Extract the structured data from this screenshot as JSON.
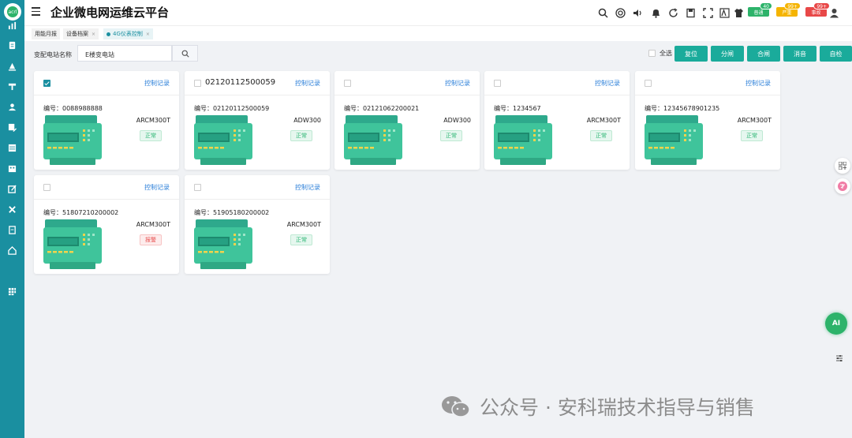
{
  "app": {
    "title": "企业微电网运维云平台",
    "logo_text": "acrl"
  },
  "tabs": [
    {
      "label": "用能月报",
      "closable": false,
      "active": false
    },
    {
      "label": "设备档案",
      "closable": true,
      "active": false
    },
    {
      "label": "4G仪表控制",
      "closable": true,
      "active": true
    }
  ],
  "tab_close_glyph": "×",
  "header_badges": [
    {
      "label": "普通",
      "count": "40",
      "color": "#2db36a"
    },
    {
      "label": "严重",
      "count": "99+",
      "color": "#f5b400"
    },
    {
      "label": "事故",
      "count": "99+",
      "color": "#e84848"
    }
  ],
  "filter": {
    "label": "变配电站名称",
    "value": "E楼变电站"
  },
  "select_all_label": "全选",
  "actions": [
    "复位",
    "分闸",
    "合闸",
    "消音",
    "自检"
  ],
  "control_link": "控制记录",
  "code_prefix": "编号：",
  "cards": [
    {
      "title": "",
      "checked": true,
      "code": "0088988888",
      "model": "ARCM300T",
      "status": "正常",
      "status_type": "ok"
    },
    {
      "title": "02120112500059",
      "checked": false,
      "code": "02120112500059",
      "model": "ADW300",
      "status": "正常",
      "status_type": "ok"
    },
    {
      "title": "",
      "checked": false,
      "code": "02121062200021",
      "model": "ADW300",
      "status": "正常",
      "status_type": "ok"
    },
    {
      "title": "",
      "checked": false,
      "code": "1234567",
      "model": "ARCM300T",
      "status": "正常",
      "status_type": "ok"
    },
    {
      "title": "",
      "checked": false,
      "code": "12345678901235",
      "model": "ARCM300T",
      "status": "正常",
      "status_type": "ok"
    },
    {
      "title": "",
      "checked": false,
      "code": "51807210200002",
      "model": "ARCM300T",
      "status": "报警",
      "status_type": "bad"
    },
    {
      "title": "",
      "checked": false,
      "code": "51905180200002",
      "model": "ARCM300T",
      "status": "正常",
      "status_type": "ok"
    }
  ],
  "ai_label": "AI",
  "watermark": "公众号 · 安科瑞技术指导与销售"
}
